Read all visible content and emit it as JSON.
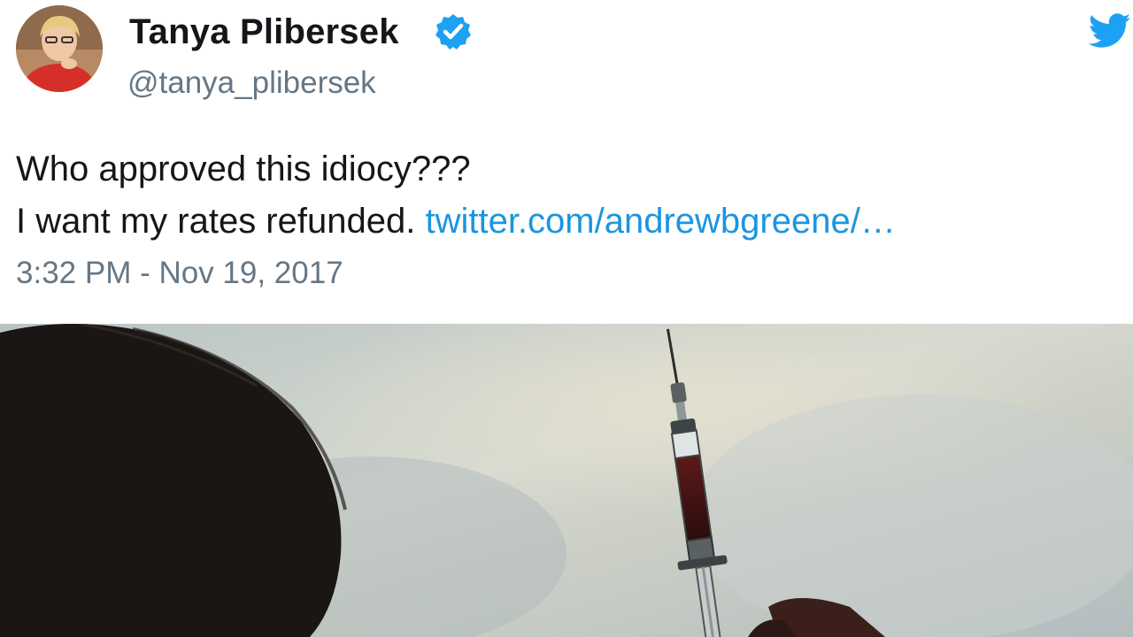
{
  "tweet": {
    "author": {
      "display_name": "Tanya Plibersek",
      "handle": "@tanya_plibersek",
      "verified": true,
      "avatar_icon": "profile-photo"
    },
    "text_lines": [
      "Who approved this idiocy???",
      "I want my rates refunded."
    ],
    "link": "twitter.com/andrewbgreene/…",
    "timestamp": "3:32 PM - Nov 19, 2017",
    "brand_icon": "twitter-bird-icon",
    "colors": {
      "brand": "#1da1f2",
      "link": "#1b95e0",
      "text": "#14171a",
      "secondary": "#657786"
    }
  },
  "photo": {
    "subject": "syringe-with-red-liquid"
  }
}
